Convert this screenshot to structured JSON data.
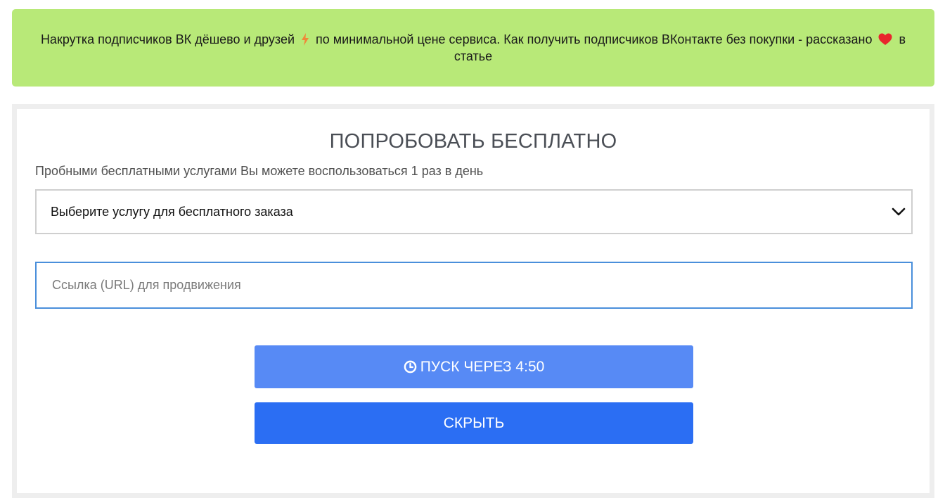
{
  "banner": {
    "text_part1": "Накрутка подписчиков ВК дёшево и друзей",
    "text_part2": "по минимальной цене сервиса. Как получить подписчиков ВКонтакте без покупки - рассказано",
    "text_part3": "в статье",
    "icon1": "lightning-icon",
    "icon2": "heart-icon",
    "colors": {
      "background": "#b8e978",
      "lightning": "#f0883a",
      "heart": "#e8262d"
    }
  },
  "form": {
    "title": "ПОПРОБОВАТЬ БЕСПЛАТНО",
    "subtitle": "Пробными бесплатными услугами Вы можете воспользоваться 1 раз в день",
    "service_select": {
      "selected": "Выберите услугу для бесплатного заказа",
      "icon": "chevron-down-icon"
    },
    "url_input": {
      "value": "",
      "placeholder": "Ссылка (URL) для продвижения"
    },
    "start_button": {
      "label": "ПУСК ЧЕРЕЗ 4:50",
      "icon": "clock-icon",
      "color": "#578af5"
    },
    "hide_button": {
      "label": "СКРЫТЬ",
      "color": "#2b6ef3"
    }
  }
}
